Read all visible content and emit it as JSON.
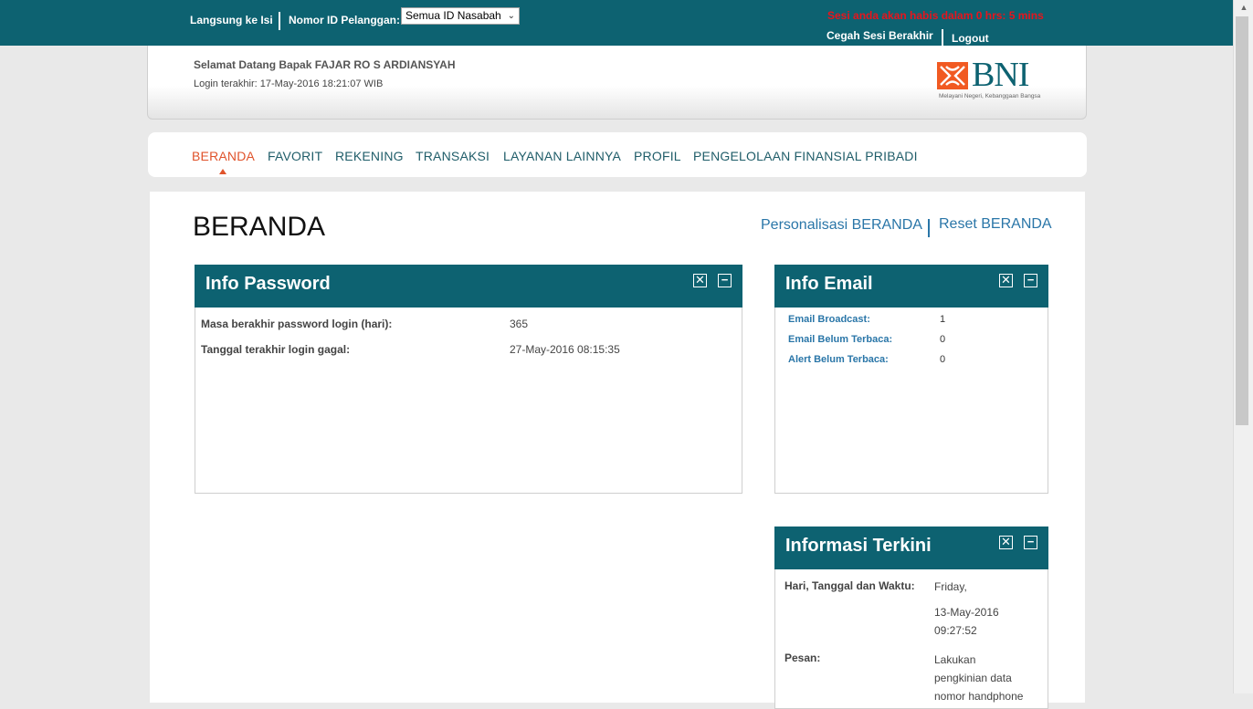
{
  "topbar": {
    "skip_label": "Langsung ke Isi",
    "customer_id_label": "Nomor ID Pelanggan:",
    "customer_select": "Semua ID Nasabah",
    "session_warning": "Sesi anda akan habis dalam 0 hrs: 5 mins",
    "prevent_session_end": "Cegah Sesi Berakhir",
    "logout": "Logout",
    "colors": {
      "bar": "#0d6271",
      "warning": "#e8141c"
    }
  },
  "welcome": {
    "greeting": "Selamat Datang Bapak  FAJAR  RO S  ARDIANSYAH",
    "last_login": "Login terakhir:  17-May-2016 18:21:07  WIB"
  },
  "logo": {
    "brand": "BNI",
    "tagline": "Melayani Negeri, Kebanggaan Bangsa",
    "mark_color": "#f15a22"
  },
  "nav": {
    "items": [
      "BERANDA",
      "FAVORIT",
      "REKENING",
      "TRANSAKSI",
      "LAYANAN LAINNYA",
      "PROFIL",
      "PENGELOLAAN FINANSIAL PRIBADI"
    ],
    "active": "BERANDA",
    "colors": {
      "active": "#e0532b",
      "default": "#1f5d69"
    }
  },
  "page": {
    "title": "BERANDA",
    "personalize_link": "Personalisasi BERANDA",
    "reset_link": "Reset BERANDA"
  },
  "info_password": {
    "title": "Info Password",
    "expiry_label": "Masa berakhir password login (hari):",
    "expiry_value": "365",
    "last_failed_label": "Tanggal terakhir login gagal:",
    "last_failed_value": "27-May-2016 08:15:35"
  },
  "info_email": {
    "title": "Info Email",
    "rows": [
      {
        "label": "Email Broadcast:",
        "value": "1"
      },
      {
        "label": "Email Belum Terbaca:",
        "value": "0"
      },
      {
        "label": "Alert Belum Terbaca:",
        "value": "0"
      }
    ]
  },
  "informasi_terkini": {
    "title": "Informasi Terkini",
    "datetime_label": "Hari, Tanggal dan Waktu:",
    "day": "Friday,",
    "date": "13-May-2016",
    "time": "09:27:52",
    "message_label": "Pesan:",
    "message_line1": "Lakukan",
    "message_line2": "pengkinian data",
    "message_line3": "nomor handphone"
  },
  "panel_buttons": {
    "close": "✕",
    "minimize": "−"
  }
}
